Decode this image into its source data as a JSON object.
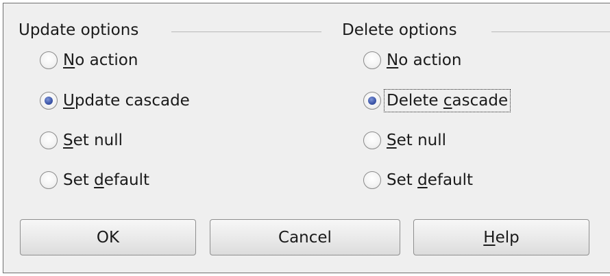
{
  "update_options": {
    "title": "Update options",
    "options": [
      {
        "pre": "",
        "key": "N",
        "post": "o action",
        "checked": false
      },
      {
        "pre": "",
        "key": "U",
        "post": "pdate cascade",
        "checked": true
      },
      {
        "pre": "",
        "key": "S",
        "post": "et null",
        "checked": false
      },
      {
        "pre": "Set ",
        "key": "d",
        "post": "efault",
        "checked": false
      }
    ]
  },
  "delete_options": {
    "title": "Delete options",
    "options": [
      {
        "pre": "",
        "key": "N",
        "post": "o action",
        "checked": false
      },
      {
        "pre": "Delete ",
        "key": "c",
        "post": "ascade",
        "checked": true,
        "focused": true
      },
      {
        "pre": "",
        "key": "S",
        "post": "et null",
        "checked": false
      },
      {
        "pre": "Set ",
        "key": "d",
        "post": "efault",
        "checked": false
      }
    ]
  },
  "buttons": {
    "ok": {
      "label": "OK"
    },
    "cancel": {
      "label": "Cancel"
    },
    "help": {
      "pre": "",
      "key": "H",
      "post": "elp"
    }
  }
}
